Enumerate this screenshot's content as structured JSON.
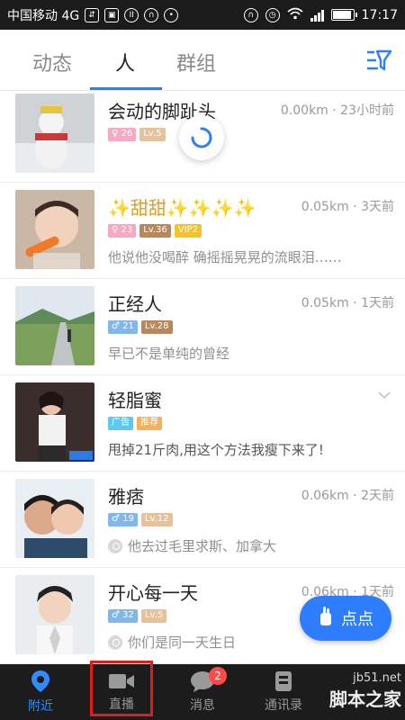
{
  "status_bar": {
    "carrier": "中国移动 4G",
    "network_badge": "4G",
    "time": "17:17",
    "battery_level": 0.85
  },
  "tabs": [
    {
      "label": "动态",
      "active": false
    },
    {
      "label": "人",
      "active": true
    },
    {
      "label": "群组",
      "active": false
    }
  ],
  "people": [
    {
      "name": "会动的脚趾头",
      "distance": "0.00km",
      "time": "23小时前",
      "badges": [
        "♀ 26",
        "Lv.5"
      ],
      "desc": ""
    },
    {
      "name": "✨甜甜✨✨✨✨",
      "distance": "0.05km",
      "time": "3天前",
      "badges": [
        "♀ 23",
        "Lv.36",
        "VIP2"
      ],
      "desc": "他说他没喝醉 确摇摇晃晃的流眼泪……"
    },
    {
      "name": "正经人",
      "distance": "0.05km",
      "time": "1天前",
      "badges": [
        "♂ 21",
        "Lv.28"
      ],
      "desc": "早已不是单纯的曾经"
    },
    {
      "name": "轻脂蜜",
      "distance": "",
      "time": "",
      "badges": [
        "广告",
        "推荐"
      ],
      "desc": "甩掉21斤肉,用这个方法我瘦下来了!"
    },
    {
      "name": "雅痞",
      "distance": "0.06km",
      "time": "2天前",
      "badges": [
        "♂ 19",
        "Lv.12"
      ],
      "desc": "他去过毛里求斯、加拿大"
    },
    {
      "name": "开心每一天",
      "distance": "0.06km",
      "time": "1天前",
      "badges": [
        "♂ 32",
        "Lv.5"
      ],
      "desc": "你们是同一天生日"
    }
  ],
  "fab": {
    "label": "点点"
  },
  "bottom_nav": [
    {
      "label": "附近",
      "active": true
    },
    {
      "label": "直播",
      "active": false
    },
    {
      "label": "消息",
      "active": false,
      "badge": "2"
    },
    {
      "label": "通讯录",
      "active": false
    },
    {
      "label": "",
      "active": false
    }
  ],
  "watermark": {
    "line1": "jb51.net",
    "line2": "脚本之家"
  },
  "colors": {
    "accent": "#2f7dff",
    "nav_bg": "#1c1c1c",
    "badge_red": "#ff4a4a"
  }
}
